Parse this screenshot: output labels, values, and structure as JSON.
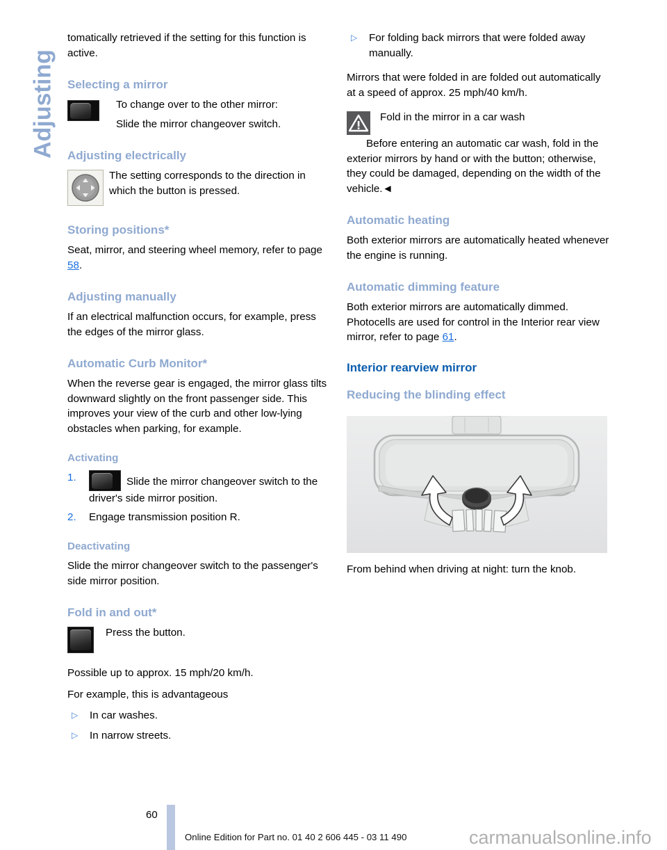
{
  "chapter_tab": {
    "label": "Adjusting"
  },
  "left_column": {
    "intro_paragraph": "tomatically retrieved if the setting for this function is active.",
    "selecting_mirror": {
      "heading": "Selecting a mirror",
      "line1": "To change over to the other mirror:",
      "line2": "Slide the mirror changeover switch.",
      "icon": "mirror-changeover-switch-icon"
    },
    "adjusting_electrically": {
      "heading": "Adjusting electrically",
      "text": "The setting corresponds to the direction in which the button is pressed.",
      "icon": "directional-pad-button-icon"
    },
    "storing_positions": {
      "heading": "Storing positions*",
      "text_before": "Seat, mirror, and steering wheel memory, refer to page ",
      "page_link": "58",
      "text_after": "."
    },
    "adjusting_manually": {
      "heading": "Adjusting manually",
      "text": "If an electrical malfunction occurs, for example, press the edges of the mirror glass."
    },
    "automatic_curb_monitor": {
      "heading": "Automatic Curb Monitor*",
      "text": "When the reverse gear is engaged, the mirror glass tilts downward slightly on the front passenger side. This improves your view of the curb and other low-lying obstacles when parking, for example."
    },
    "activating": {
      "heading": "Activating",
      "steps": [
        {
          "marker": "1.",
          "text": "Slide the mirror changeover switch to the driver's side mirror position.",
          "icon": "mirror-changeover-switch-icon"
        },
        {
          "marker": "2.",
          "text": "Engage transmission position R."
        }
      ]
    },
    "deactivating": {
      "heading": "Deactivating",
      "text": "Slide the mirror changeover switch to the passenger's side mirror position."
    },
    "fold_in_and_out": {
      "heading": "Fold in and out*",
      "icon": "fold-mirror-button-icon",
      "press_text": "Press the button.",
      "speed_text": "Possible up to approx. 15 mph/20 km/h.",
      "example_text": "For example, this is advantageous",
      "bullets": [
        {
          "marker": "▷",
          "text": "In car washes."
        },
        {
          "marker": "▷",
          "text": "In narrow streets."
        }
      ]
    }
  },
  "right_column": {
    "top_bullet": {
      "marker": "▷",
      "text": "For folding back mirrors that were folded away manually."
    },
    "fold_out_paragraph": "Mirrors that were folded in are folded out automatically at a speed of approx. 25 mph/40 km/h.",
    "warning": {
      "icon": "warning-triangle-icon",
      "title": "Fold in the mirror in a car wash",
      "body": "Before entering an automatic car wash, fold in the exterior mirrors by hand or with the button; otherwise, they could be damaged, depending on the width of the vehicle.◄"
    },
    "automatic_heating": {
      "heading": "Automatic heating",
      "text": "Both exterior mirrors are automatically heated whenever the engine is running."
    },
    "automatic_dimming": {
      "heading": "Automatic dimming feature",
      "text_before": "Both exterior mirrors are automatically dimmed. Photocells are used for control in the Interior rear view mirror, refer to page ",
      "page_link": "61",
      "text_after": "."
    },
    "interior_rearview_mirror": {
      "heading": "Interior rearview mirror",
      "sub_heading": "Reducing the blinding effect",
      "figure_name": "interior-rearview-mirror-illustration",
      "caption": "From behind when driving at night: turn the knob."
    }
  },
  "footer": {
    "page_number": "60",
    "edition_line": "Online Edition for Part no. 01 40 2 606 445 - 03 11 490",
    "watermark": "carmanualsonline.info"
  },
  "colors": {
    "chapter_tab_blue": "#8fa9d0",
    "section_heading_blue": "#0a5cad",
    "sub_heading_blue": "#8fa9d0",
    "page_link_blue": "#1a6fe0",
    "footer_bar_blue": "#b9c7e0",
    "warning_icon_gray": "#58585a"
  }
}
